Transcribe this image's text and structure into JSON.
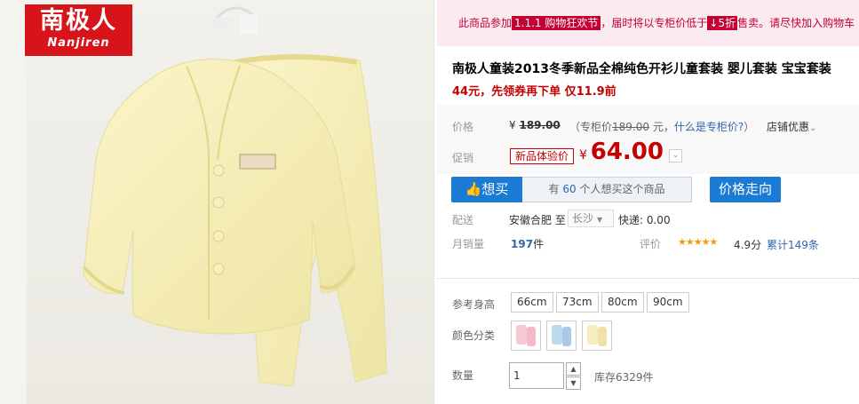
{
  "brand": {
    "logo_cn": "南极人",
    "logo_en": "Nanjiren"
  },
  "promo": {
    "prefix": "此商品参加",
    "tag": "1.1.1 购物狂欢节",
    "middle": "，届时将以专柜价低于",
    "discount": "↓5折",
    "suffix": "售卖。请尽快加入购物车"
  },
  "product": {
    "title": "南极人童装2013冬季新品全棉纯色开衫儿童套装 婴儿套装 宝宝套装",
    "subtitle": "44元，先领券再下单 仅11.9前"
  },
  "price": {
    "label": "价格",
    "currency": "¥",
    "original": "189.00",
    "ref_prefix": "（专柜价",
    "ref_value": "189.00",
    "ref_unit": " 元，",
    "ref_link": "什么是专柜价?",
    "ref_suffix": "）",
    "store_discount": "店铺优惠"
  },
  "promotion": {
    "label": "促销",
    "badge": "新品体验价",
    "currency": "¥",
    "price": "64.00"
  },
  "buttons": {
    "want": "想买",
    "want_prefix": "有",
    "want_count": "60",
    "want_suffix": "个人想买这个商品",
    "price_trend": "价格走向"
  },
  "shipping": {
    "label": "配送",
    "from": "安徽合肥",
    "to_word": "至",
    "destination": "长沙",
    "express": "快递: 0.00"
  },
  "sales": {
    "label": "月销量",
    "count": "197",
    "unit": "件",
    "rating_label": "评价",
    "stars": "★★★★★",
    "score": "4.9分",
    "reviews": "累计149条"
  },
  "sku": {
    "size_label": "参考身高",
    "sizes": [
      "66cm",
      "73cm",
      "80cm",
      "90cm"
    ],
    "color_label": "颜色分类",
    "colors": [
      "#f6c9d3",
      "#bcd9ef",
      "#f6ecc0"
    ]
  },
  "quantity": {
    "label": "数量",
    "value": "1",
    "stock": "库存6329件"
  },
  "colors": {
    "accent_red": "#c40000",
    "accent_blue": "#1b7bd4"
  }
}
